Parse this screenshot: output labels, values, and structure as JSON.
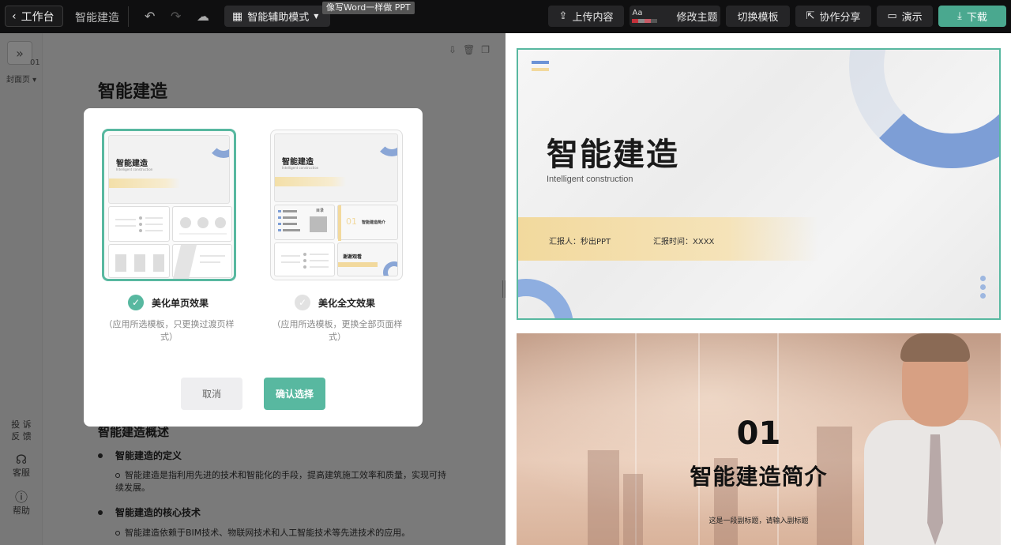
{
  "topbar": {
    "back_label": "工作台",
    "doc_name": "智能建造",
    "mode_label": "智能辅助模式",
    "tooltip": "像写Word一样做 PPT",
    "upload_label": "上传内容",
    "theme_aa": "Aa",
    "theme_label": "修改主题",
    "switch_label": "切换模板",
    "share_label": "协作分享",
    "present_label": "演示",
    "download_label": "下载"
  },
  "sidebar": {
    "page_num": "01",
    "cover_label": "封面页",
    "complaint_label_1": "投 诉",
    "complaint_label_2": "反 馈",
    "service_label": "客服",
    "help_label": "帮助"
  },
  "document": {
    "title": "智能建造",
    "section_title": "智能建造概述",
    "bullet1": "智能建造的定义",
    "bullet1_sub": "智能建造是指利用先进的技术和智能化的手段，提高建筑施工效率和质量，实现可持续发展。",
    "bullet2": "智能建造的核心技术",
    "bullet2_sub": "智能建造依赖于BIM技术、物联网技术和人工智能技术等先进技术的应用。"
  },
  "modal": {
    "option1": {
      "label": "美化单页效果",
      "desc": "（应用所选模板，只更换过渡页样式）",
      "selected": true,
      "thumb_title": "智能建造",
      "thumb_sub": "Intelligent construction"
    },
    "option2": {
      "label": "美化全文效果",
      "desc": "（应用所选模板，更换全部页面样式）",
      "selected": false,
      "thumb_title": "智能建造",
      "thumb_sub": "Intelligent construction",
      "thumb_cell_title_1": "目录",
      "thumb_cell_title_2": "智能建造简介",
      "thumb_cell_num": "01",
      "thumb_cell_title_3": "谢谢观看"
    },
    "cancel_label": "取消",
    "confirm_label": "确认选择"
  },
  "preview": {
    "slide1": {
      "title": "智能建造",
      "subtitle": "Intelligent construction",
      "reporter": "汇报人：秒出PPT",
      "report_time": "汇报时间：XXXX"
    },
    "slide2": {
      "number": "01",
      "title": "智能建造简介",
      "subtitle": "这是一段副标题，请输入副标题"
    }
  },
  "colors": {
    "accent": "#58b8a0",
    "download": "#4aa88f",
    "arc_blue": "#7d9ed6",
    "band_yellow": "#f2d99d"
  }
}
